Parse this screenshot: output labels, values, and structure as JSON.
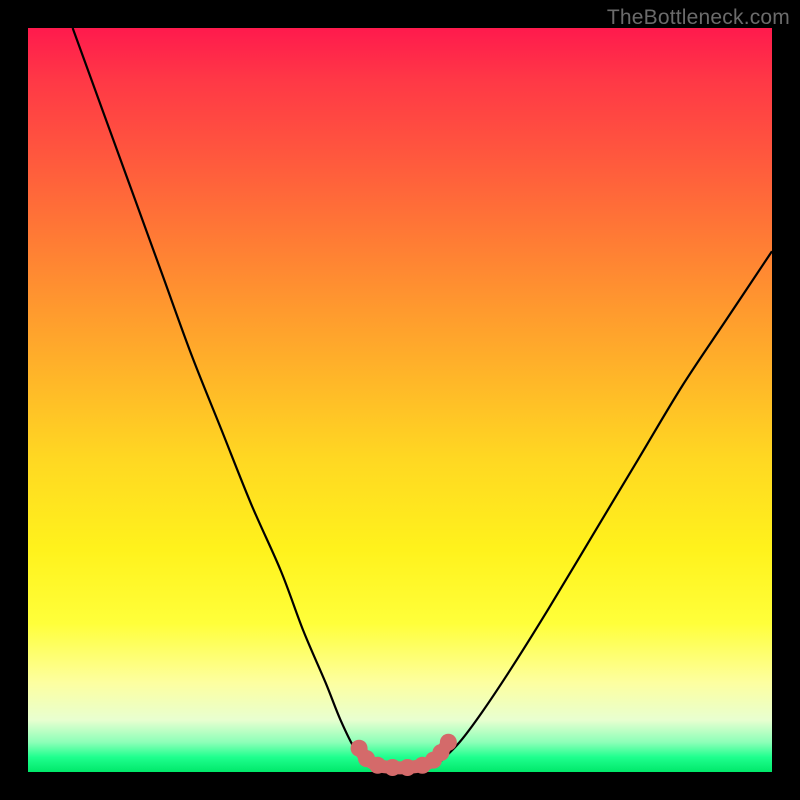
{
  "watermark": "TheBottleneck.com",
  "colors": {
    "curve_stroke": "#000000",
    "marker_stroke": "#d46a6a",
    "marker_fill": "#d46a6a"
  },
  "chart_data": {
    "type": "line",
    "title": "",
    "xlabel": "",
    "ylabel": "",
    "xlim": [
      0,
      100
    ],
    "ylim": [
      0,
      100
    ],
    "series": [
      {
        "name": "left-branch",
        "x": [
          6,
          10,
          14,
          18,
          22,
          26,
          30,
          34,
          37,
          40,
          42,
          44,
          46
        ],
        "y": [
          100,
          89,
          78,
          67,
          56,
          46,
          36,
          27,
          19,
          12,
          7,
          3,
          1
        ]
      },
      {
        "name": "right-branch",
        "x": [
          55,
          58,
          61,
          65,
          70,
          76,
          82,
          88,
          94,
          100
        ],
        "y": [
          1,
          4,
          8,
          14,
          22,
          32,
          42,
          52,
          61,
          70
        ]
      },
      {
        "name": "valley-markers",
        "x": [
          44.5,
          45.5,
          47,
          49,
          51,
          53,
          54.5,
          55.5,
          56.5
        ],
        "y": [
          3.2,
          1.8,
          0.9,
          0.6,
          0.6,
          0.9,
          1.6,
          2.6,
          4.0
        ]
      }
    ]
  }
}
